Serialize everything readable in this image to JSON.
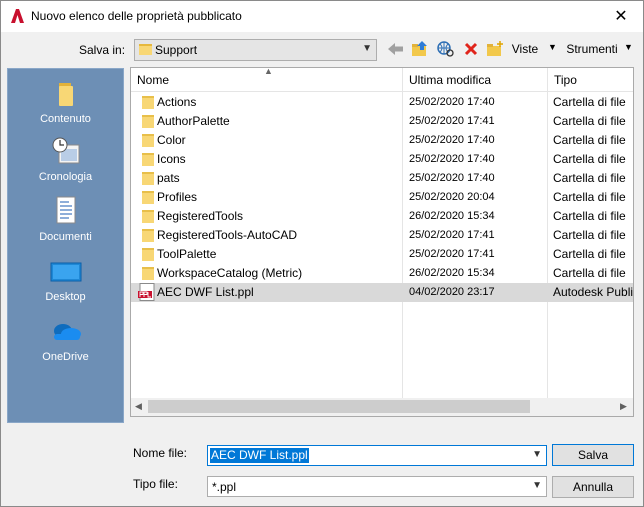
{
  "window": {
    "title": "Nuovo elenco delle proprietà pubblicato",
    "close_glyph": "✕"
  },
  "toolbar": {
    "save_in_label": "Salva in:",
    "location": "Support",
    "views_label": "Viste",
    "tools_label": "Strumenti",
    "icons": [
      "back-arrow-icon",
      "up-folder-icon",
      "search-web-icon",
      "delete-icon",
      "new-folder-icon"
    ]
  },
  "places": [
    {
      "label": "Contenuto",
      "icon": "folder-icon"
    },
    {
      "label": "Cronologia",
      "icon": "history-icon"
    },
    {
      "label": "Documenti",
      "icon": "documents-icon"
    },
    {
      "label": "Desktop",
      "icon": "desktop-icon"
    },
    {
      "label": "OneDrive",
      "icon": "onedrive-icon"
    }
  ],
  "columns": {
    "name": "Nome",
    "modified": "Ultima modifica",
    "type": "Tipo"
  },
  "files": [
    {
      "name": "Actions",
      "modified": "25/02/2020 17:40",
      "type": "Cartella di file",
      "kind": "folder"
    },
    {
      "name": "AuthorPalette",
      "modified": "25/02/2020 17:41",
      "type": "Cartella di file",
      "kind": "folder"
    },
    {
      "name": "Color",
      "modified": "25/02/2020 17:40",
      "type": "Cartella di file",
      "kind": "folder"
    },
    {
      "name": "Icons",
      "modified": "25/02/2020 17:40",
      "type": "Cartella di file",
      "kind": "folder"
    },
    {
      "name": "pats",
      "modified": "25/02/2020 17:40",
      "type": "Cartella di file",
      "kind": "folder"
    },
    {
      "name": "Profiles",
      "modified": "25/02/2020 20:04",
      "type": "Cartella di file",
      "kind": "folder"
    },
    {
      "name": "RegisteredTools",
      "modified": "26/02/2020 15:34",
      "type": "Cartella di file",
      "kind": "folder"
    },
    {
      "name": "RegisteredTools-AutoCAD",
      "modified": "25/02/2020 17:41",
      "type": "Cartella di file",
      "kind": "folder"
    },
    {
      "name": "ToolPalette",
      "modified": "25/02/2020 17:41",
      "type": "Cartella di file",
      "kind": "folder"
    },
    {
      "name": "WorkspaceCatalog (Metric)",
      "modified": "26/02/2020 15:34",
      "type": "Cartella di file",
      "kind": "folder"
    },
    {
      "name": "AEC DWF List.ppl",
      "modified": "04/02/2020 23:17",
      "type": "Autodesk Publis",
      "kind": "ppl",
      "selected": true
    }
  ],
  "footer": {
    "filename_label": "Nome file:",
    "filename_value": "AEC DWF List.ppl",
    "filetype_label": "Tipo file:",
    "filetype_value": "*.ppl",
    "save_button": "Salva",
    "cancel_button": "Annulla"
  },
  "colors": {
    "places_bg": "#6d8fb5",
    "selection": "#0078d7",
    "folder": "#f8d775"
  }
}
